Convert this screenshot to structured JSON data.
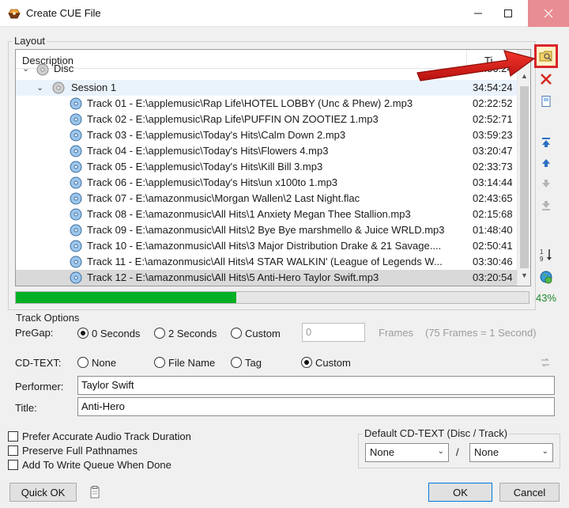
{
  "window": {
    "title": "Create CUE File"
  },
  "layout": {
    "group_label": "Layout",
    "columns": {
      "description": "Description",
      "time": "Ti"
    },
    "disc": {
      "label": "Disc",
      "time": "34:56:24"
    },
    "session": {
      "label": "Session 1",
      "time": "34:54:24"
    },
    "tracks": [
      {
        "label": "Track 01 - E:\\applemusic\\Rap Life\\HOTEL LOBBY (Unc & Phew) 2.mp3",
        "time": "02:22:52"
      },
      {
        "label": "Track 02 - E:\\applemusic\\Rap Life\\PUFFIN ON ZOOTIEZ 1.mp3",
        "time": "02:52:71"
      },
      {
        "label": "Track 03 - E:\\applemusic\\Today's Hits\\Calm Down 2.mp3",
        "time": "03:59:23"
      },
      {
        "label": "Track 04 - E:\\applemusic\\Today's Hits\\Flowers 4.mp3",
        "time": "03:20:47"
      },
      {
        "label": "Track 05 - E:\\applemusic\\Today's Hits\\Kill Bill 3.mp3",
        "time": "02:33:73"
      },
      {
        "label": "Track 06 - E:\\applemusic\\Today's Hits\\un x100to 1.mp3",
        "time": "03:14:44"
      },
      {
        "label": "Track 07 - E:\\amazonmusic\\Morgan Wallen\\2 Last Night.flac",
        "time": "02:43:65"
      },
      {
        "label": "Track 08 - E:\\amazonmusic\\All Hits\\1 Anxiety Megan Thee Stallion.mp3",
        "time": "02:15:68"
      },
      {
        "label": "Track 09 - E:\\amazonmusic\\All Hits\\2 Bye Bye marshmello & Juice WRLD.mp3",
        "time": "01:48:40"
      },
      {
        "label": "Track 10 - E:\\amazonmusic\\All Hits\\3 Major Distribution Drake & 21 Savage....",
        "time": "02:50:41"
      },
      {
        "label": "Track 11 - E:\\amazonmusic\\All Hits\\4 STAR WALKIN' (League of Legends W...",
        "time": "03:30:46"
      },
      {
        "label": "Track 12 - E:\\amazonmusic\\All Hits\\5 Anti-Hero Taylor Swift.mp3",
        "time": "03:20:54"
      }
    ],
    "selected_track_index": 11,
    "progress_fraction": 0.43,
    "progress_text": "43%"
  },
  "track_options": {
    "group_label": "Track Options",
    "pregap": {
      "label": "PreGap:",
      "options": [
        "0 Seconds",
        "2 Seconds",
        "Custom"
      ],
      "selected": "0 Seconds",
      "custom_value": "0",
      "frames_label": "Frames",
      "frames_hint": "(75 Frames = 1 Second)"
    },
    "cdtext": {
      "label": "CD-TEXT:",
      "options": [
        "None",
        "File Name",
        "Tag",
        "Custom"
      ],
      "selected": "Custom"
    },
    "performer": {
      "label": "Performer:",
      "value": "Taylor Swift"
    },
    "title": {
      "label": "Title:",
      "value": "Anti-Hero"
    }
  },
  "checkboxes": [
    {
      "label": "Prefer Accurate Audio Track Duration",
      "checked": false
    },
    {
      "label": "Preserve Full Pathnames",
      "checked": false
    },
    {
      "label": "Add To Write Queue When Done",
      "checked": false
    }
  ],
  "default_cdtext": {
    "group_label": "Default CD-TEXT (Disc / Track)",
    "disc_value": "None",
    "separator": "/",
    "track_value": "None"
  },
  "buttons": {
    "quick_ok": "Quick OK",
    "ok": "OK",
    "cancel": "Cancel"
  },
  "icons": {
    "highlighted_button": "folder-search-icon",
    "annotation": "red-arrow-icon"
  },
  "colors": {
    "progress_fill": "#06b025",
    "progress_text": "#1f8a2a",
    "highlight_border": "#d9252a",
    "close_button": "#e88d92"
  }
}
